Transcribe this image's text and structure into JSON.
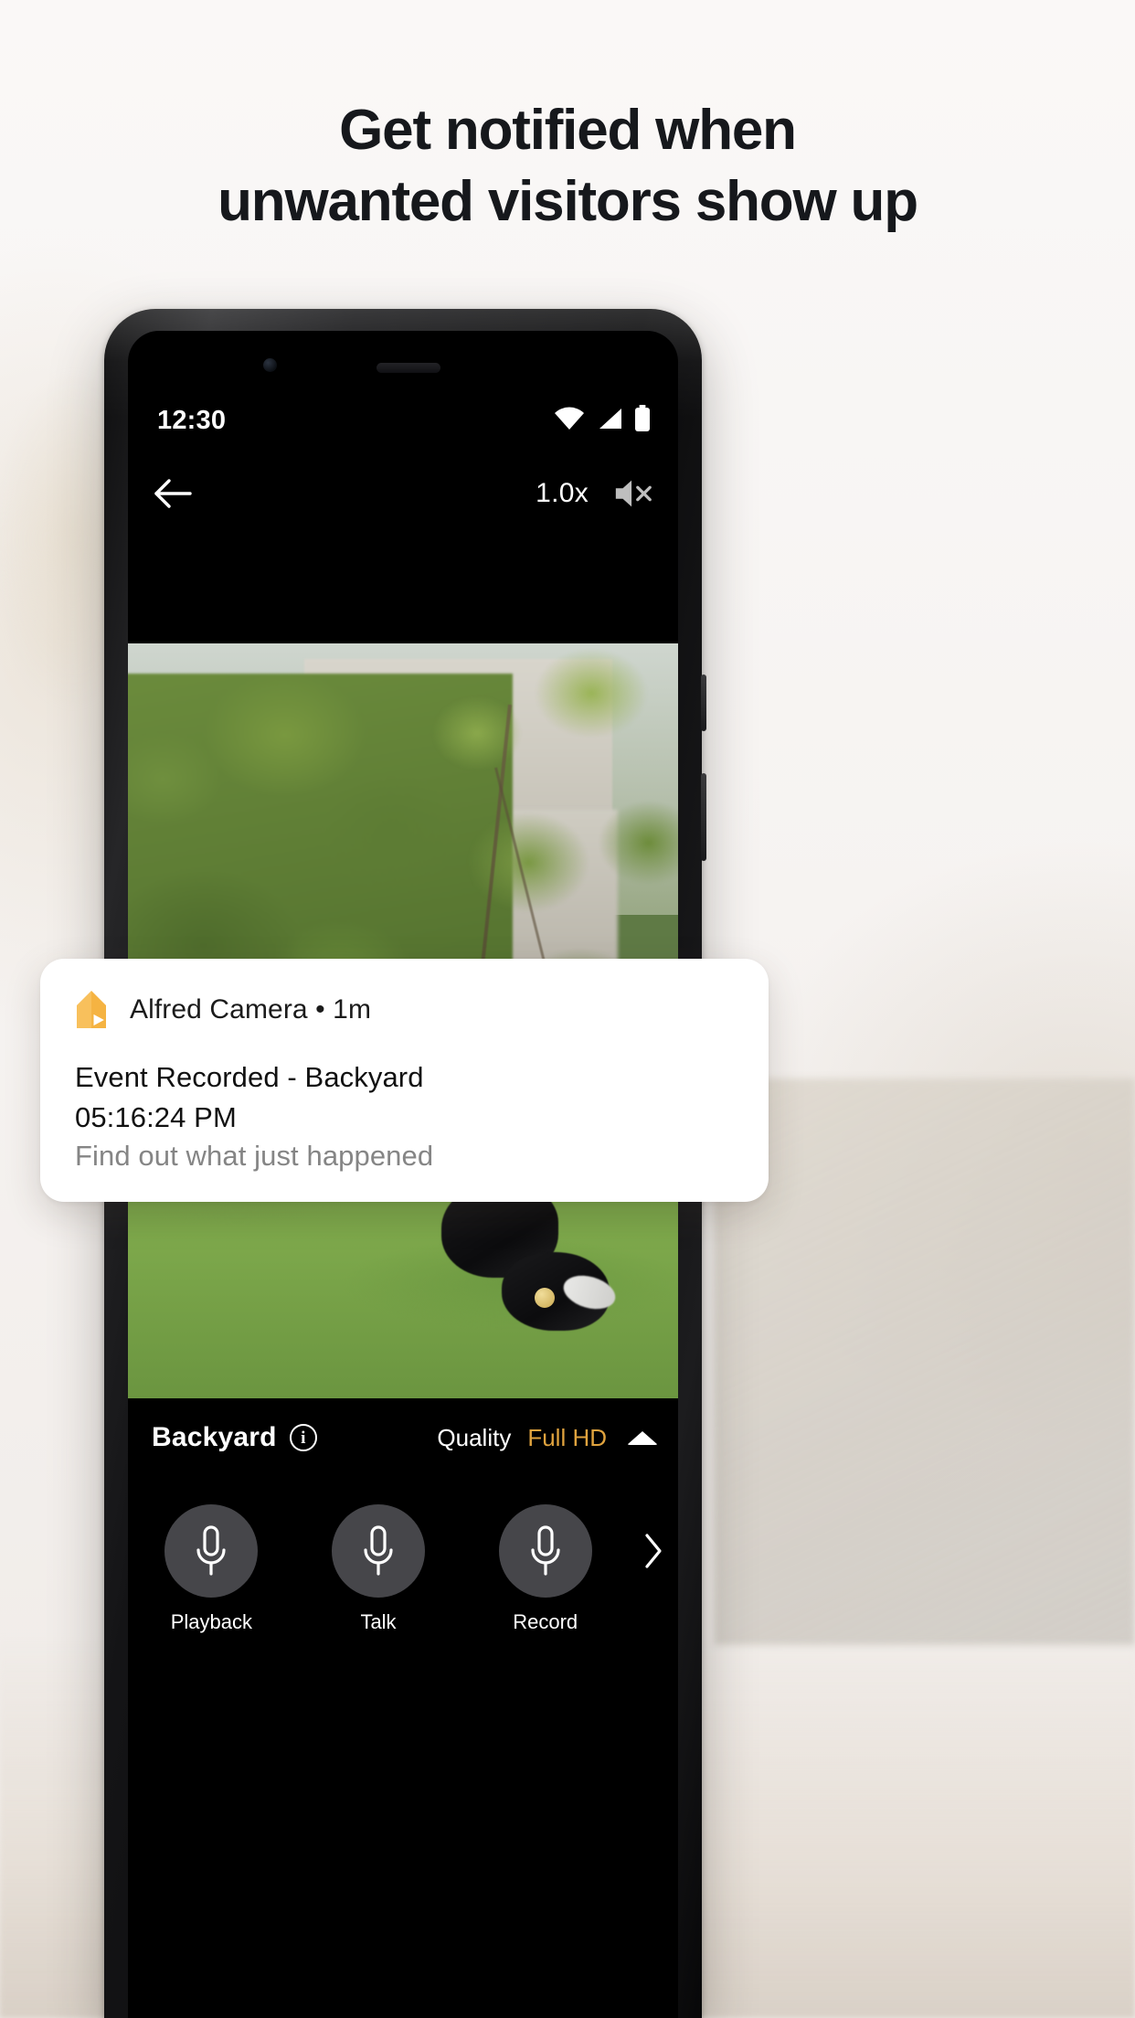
{
  "headline": {
    "line1": "Get notified when",
    "line2": "unwanted visitors show up"
  },
  "phone": {
    "status_bar": {
      "time": "12:30",
      "icons": [
        "wifi-icon",
        "cellular-signal-icon",
        "battery-icon"
      ]
    },
    "player_top": {
      "back_icon": "back-arrow-icon",
      "speed": "1.0x",
      "mute_icon": "speaker-muted-icon"
    },
    "info_bar": {
      "camera_name": "Backyard",
      "info_icon_label": "i",
      "quality_label": "Quality",
      "quality_value": "Full HD",
      "expand_icon": "caret-up-icon"
    },
    "controls": [
      {
        "label": "Playback",
        "icon": "microphone-icon"
      },
      {
        "label": "Talk",
        "icon": "microphone-icon"
      },
      {
        "label": "Record",
        "icon": "microphone-icon"
      }
    ],
    "controls_next_icon": "chevron-right-icon"
  },
  "notification": {
    "app_icon": "alfred-home-play-icon",
    "app_name": "Alfred Camera • 1m",
    "title": "Event Recorded - Backyard",
    "time": "05:16:24 PM",
    "subtitle": "Find out what just happened"
  },
  "colors": {
    "accent_gold": "#e0a33e",
    "brand_orange": "#f5b342",
    "page_bg": "#f7f5f4",
    "screen_bg": "#000000"
  }
}
